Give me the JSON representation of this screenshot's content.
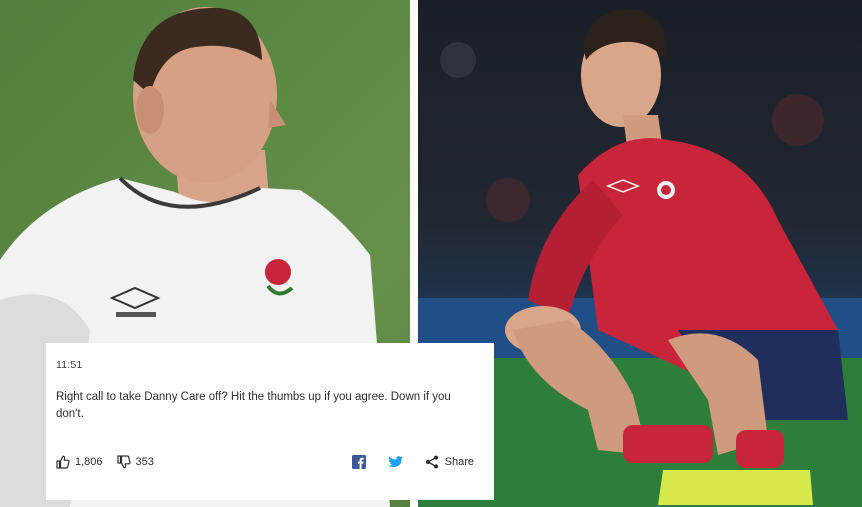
{
  "post": {
    "time": "11:51",
    "text": "Right call to take Danny Care off? Hit the thumbs up if you agree. Down if you don't.",
    "likes": "1,806",
    "dislikes": "353",
    "share_label": "Share"
  },
  "icons": {
    "like": "thumbs-up-icon",
    "dislike": "thumbs-down-icon",
    "facebook": "facebook-icon",
    "twitter": "twitter-icon",
    "share": "share-icon"
  },
  "colors": {
    "facebook": "#3b5998",
    "twitter": "#1da1f2",
    "jersey_red": "#c8253a",
    "jersey_white": "#f4f4f4",
    "pitch_green": "#5d8a44"
  }
}
